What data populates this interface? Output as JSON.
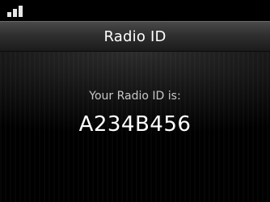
{
  "status_bar": {
    "signal_icon": "signal-strength-icon"
  },
  "header": {
    "title": "Radio ID"
  },
  "main": {
    "prompt": "Your Radio ID is:",
    "radio_id": "A234B456"
  },
  "colors": {
    "background": "#000000",
    "title_bar": "#2f2f2f",
    "text_primary": "#ffffff",
    "text_secondary": "#c8c8c8"
  }
}
